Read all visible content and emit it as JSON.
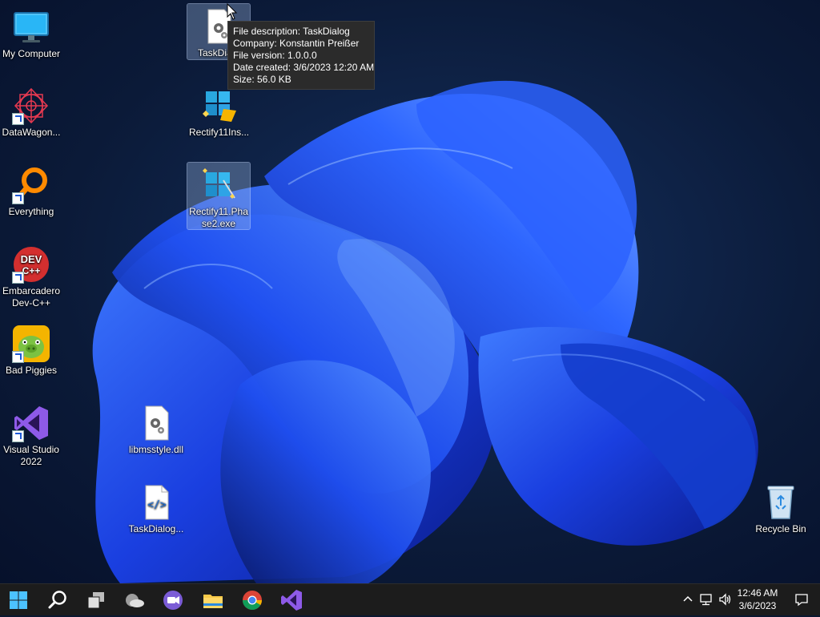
{
  "desktop": {
    "icons_left": [
      {
        "label": "My Computer",
        "icon": "monitor-icon"
      },
      {
        "label": "DataWagon...",
        "icon": "datawagon-icon"
      },
      {
        "label": "Everything",
        "icon": "everything-search-icon"
      },
      {
        "label": "Embarcadero Dev-C++",
        "icon": "devcpp-icon"
      },
      {
        "label": "Bad Piggies",
        "icon": "bad-piggies-icon"
      },
      {
        "label": "Visual Studio 2022",
        "icon": "visual-studio-icon"
      }
    ],
    "icons_col2": [
      {
        "label": "TaskDialo",
        "icon": "dll-gear-icon"
      },
      {
        "label": "Rectify11Ins...",
        "icon": "rectify11-icon"
      },
      {
        "label": "Rectify11.Phase2.exe",
        "label_line1": "Rectify11.Pha",
        "label_line2": "se2.exe",
        "icon": "rectify11-icon"
      },
      {
        "label": "libmsstyle.dll",
        "icon": "dll-gear-icon"
      },
      {
        "label": "TaskDialog...",
        "icon": "code-file-icon"
      }
    ],
    "recycle_bin": {
      "label": "Recycle Bin",
      "icon": "recycle-bin-icon"
    }
  },
  "tooltip": {
    "description": "File description: TaskDialog",
    "company": "Company: Konstantin Preißer",
    "version": "File version: 1.0.0.0",
    "date_created": "Date created: 3/6/2023 12:20 AM",
    "size": "Size: 56.0 KB"
  },
  "taskbar": {
    "buttons": [
      "start-icon",
      "search-icon",
      "task-view-icon",
      "weather-icon",
      "meet-icon",
      "file-explorer-icon",
      "chrome-icon",
      "visual-studio-icon"
    ],
    "tray": {
      "time": "12:46 AM",
      "date": "3/6/2023",
      "icons": [
        "chevron-up-icon",
        "network-icon",
        "volume-icon",
        "notification-icon"
      ]
    }
  },
  "colors": {
    "taskbar_bg": "#1c1c1c",
    "wallpaper_bg": "#0a1730",
    "bloom_blue": "#1f4ff0"
  }
}
